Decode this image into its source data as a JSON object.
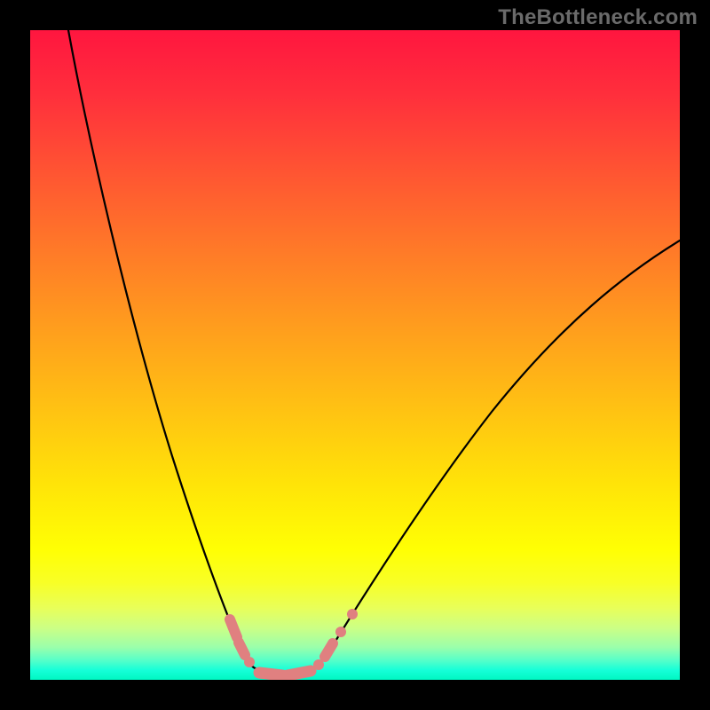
{
  "watermark_text": "TheBottleneck.com",
  "colors": {
    "frame": "#000000",
    "curve": "#000000",
    "marker": "#e08080"
  },
  "chart_data": {
    "type": "line",
    "title": "",
    "xlabel": "",
    "ylabel": "",
    "xlim": [
      0,
      100
    ],
    "ylim": [
      0,
      100
    ],
    "x": [
      0,
      4,
      8,
      12,
      16,
      20,
      23,
      25,
      27,
      29,
      31,
      33,
      35,
      37,
      39,
      41,
      43,
      45,
      48,
      52,
      56,
      60,
      64,
      68,
      72,
      76,
      80,
      84,
      88,
      92,
      96,
      100
    ],
    "series": [
      {
        "name": "bottleneck-curve",
        "values": [
          100,
          89,
          76,
          64,
          53,
          42,
          34,
          29,
          24,
          19,
          14,
          10,
          6,
          3.5,
          2,
          2,
          2.5,
          4,
          7,
          12,
          18,
          24,
          30,
          35,
          40,
          45,
          50,
          54,
          58,
          62,
          65,
          68
        ]
      }
    ],
    "flat_region": {
      "x_start": 32,
      "x_end": 44,
      "y": 2
    }
  }
}
